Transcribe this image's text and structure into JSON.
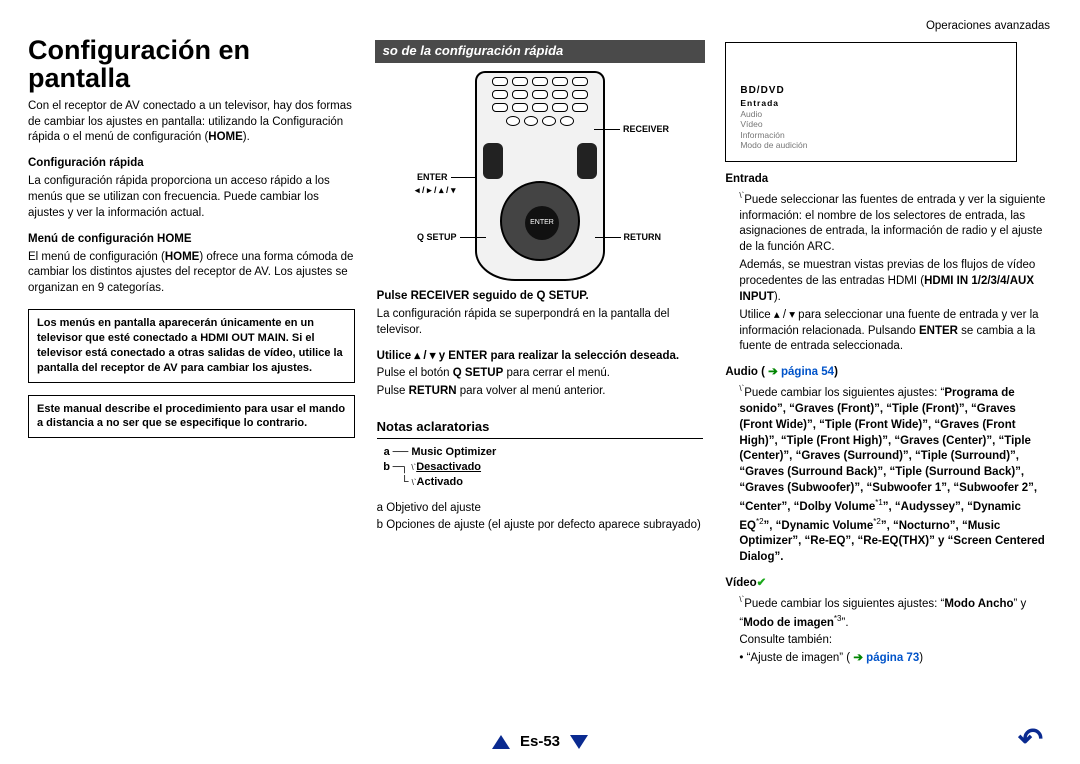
{
  "header": {
    "section_right": "Operaciones avanzadas"
  },
  "col1": {
    "h1_a": "Configuración en",
    "h1_b": "pantalla",
    "intro": "Con el receptor de AV conectado a un televisor, hay dos formas de cambiar los ajustes en pantalla: utilizando la Configuración rápida o el menú de configuración (",
    "intro_bold": "HOME",
    "intro_end": ").",
    "quick_h": "Configuración rápida",
    "quick_p": "La configuración rápida proporciona un acceso rápido a los menús que se utilizan con frecuencia. Puede cambiar los ajustes y ver la información actual.",
    "home_h": "Menú de configuración HOME",
    "home_p_a": "El menú de configuración (",
    "home_p_b": "HOME",
    "home_p_c": ") ofrece una forma cómoda de cambiar los distintos ajustes del receptor de AV. Los ajustes se organizan en 9 categorías.",
    "note1_a": "Los menús en pantalla aparecerán únicamente en un televisor que esté conectado a ",
    "note1_b": "HDMI OUT MAIN",
    "note1_c": ". Si el televisor está conectado a otras salidas de vídeo, utilice la pantalla del receptor de AV para cambiar los ajustes.",
    "note2": "Este manual describe el procedimiento para usar el mando a distancia a no ser que se especifique lo contrario."
  },
  "col2": {
    "band": "so de la configuración rápida",
    "callouts": {
      "receiver": "RECEIVER",
      "enter": "ENTER",
      "arrows": "◂ / ▸ / ▴ / ▾",
      "qsetup": "Q SETUP",
      "return": "RETURN"
    },
    "step1_a": "Pulse ",
    "step1_b": "RECEIVER",
    "step1_c": " seguido de ",
    "step1_d": "Q SETUP",
    "step1_e": ".",
    "step1_sub": "La configuración rápida se superpondrá en la pantalla del televisor.",
    "step2_a": "Utilice   ▴ / ▾ y ",
    "step2_b": "ENTER",
    "step2_c": " para realizar la selección deseada.",
    "step2_sub1_a": "Pulse el botón ",
    "step2_sub1_b": "Q SETUP",
    "step2_sub1_c": " para cerrar el menú.",
    "step2_sub2_a": "Pulse ",
    "step2_sub2_b": "RETURN",
    "step2_sub2_c": " para volver al menú anterior.",
    "notes_h": "Notas aclaratorias",
    "mo_letter_a": "a",
    "mo_title": "Music Optimizer",
    "mo_letter_b": "b",
    "mo_opt1": "Desactivado",
    "mo_opt2": "Activado",
    "legend_a": "a  Objetivo del ajuste",
    "legend_b": "b  Opciones de ajuste (el ajuste por defecto aparece subrayado)"
  },
  "col3": {
    "screen": {
      "line1": "BD/DVD",
      "line2": "Entrada",
      "line3": "Audio",
      "line4": "Vídeo",
      "line5": "Información",
      "line6": "Modo de audición"
    },
    "entrada_h": "Entrada",
    "entrada_p": "Puede seleccionar las fuentes de entrada y ver la siguiente información: el nombre de los selectores de entrada, las asignaciones de entrada, la información de radio y el ajuste de la función ARC.",
    "entrada_p2_a": "Además, se muestran vistas previas de los flujos de vídeo procedentes de las entradas HDMI (",
    "entrada_p2_b": "HDMI IN 1/2/3/4/AUX INPUT",
    "entrada_p2_c": ").",
    "entrada_use_a": "Utilice  ▴ / ▾ para seleccionar una fuente de entrada y ver la información relacionada. Pulsando ",
    "entrada_use_b": "ENTER",
    "entrada_use_c": " se cambia a la fuente de entrada seleccionada.",
    "audio_h": "Audio",
    "audio_link": "página 54",
    "audio_intro": "Puede cambiar los siguientes ajustes: “",
    "audio_items": "Programa de sonido”, “Graves (Front)”, “Tiple (Front)”, “Graves (Front Wide)”, “Tiple (Front Wide)”, “Graves (Front High)”, “Tiple (Front High)”, “Graves (Center)”, “Tiple (Center)”, “Graves (Surround)”, “Tiple (Surround)”, “Graves (Surround Back)”, “Tiple (Surround Back)”, “Graves (Subwoofer)”, “Subwoofer 1”, “Subwoofer 2”, “Center”, “Dolby Volume",
    "audio_after_dolby": "”, “Audyssey”, “Dynamic EQ",
    "audio_after_eq": "”, “Dynamic Volume",
    "audio_after_dv": "”, “Nocturno”, “Music Optimizer”, “Re-EQ”, “Re-EQ(THX)” y “Screen Centered Dialog”.",
    "video_h": "Vídeo",
    "video_p_a": "Puede cambiar los siguientes ajustes: “",
    "video_p_b": "Modo Ancho",
    "video_p_c": "” y “",
    "video_p_d": "Modo de imagen",
    "video_p_e": "”.",
    "video_also": "Consulte también:",
    "video_bullet": "• “Ajuste de imagen” (",
    "video_link": "página 73",
    "video_bullet_end": ")"
  },
  "footer": {
    "page": "Es-53"
  }
}
